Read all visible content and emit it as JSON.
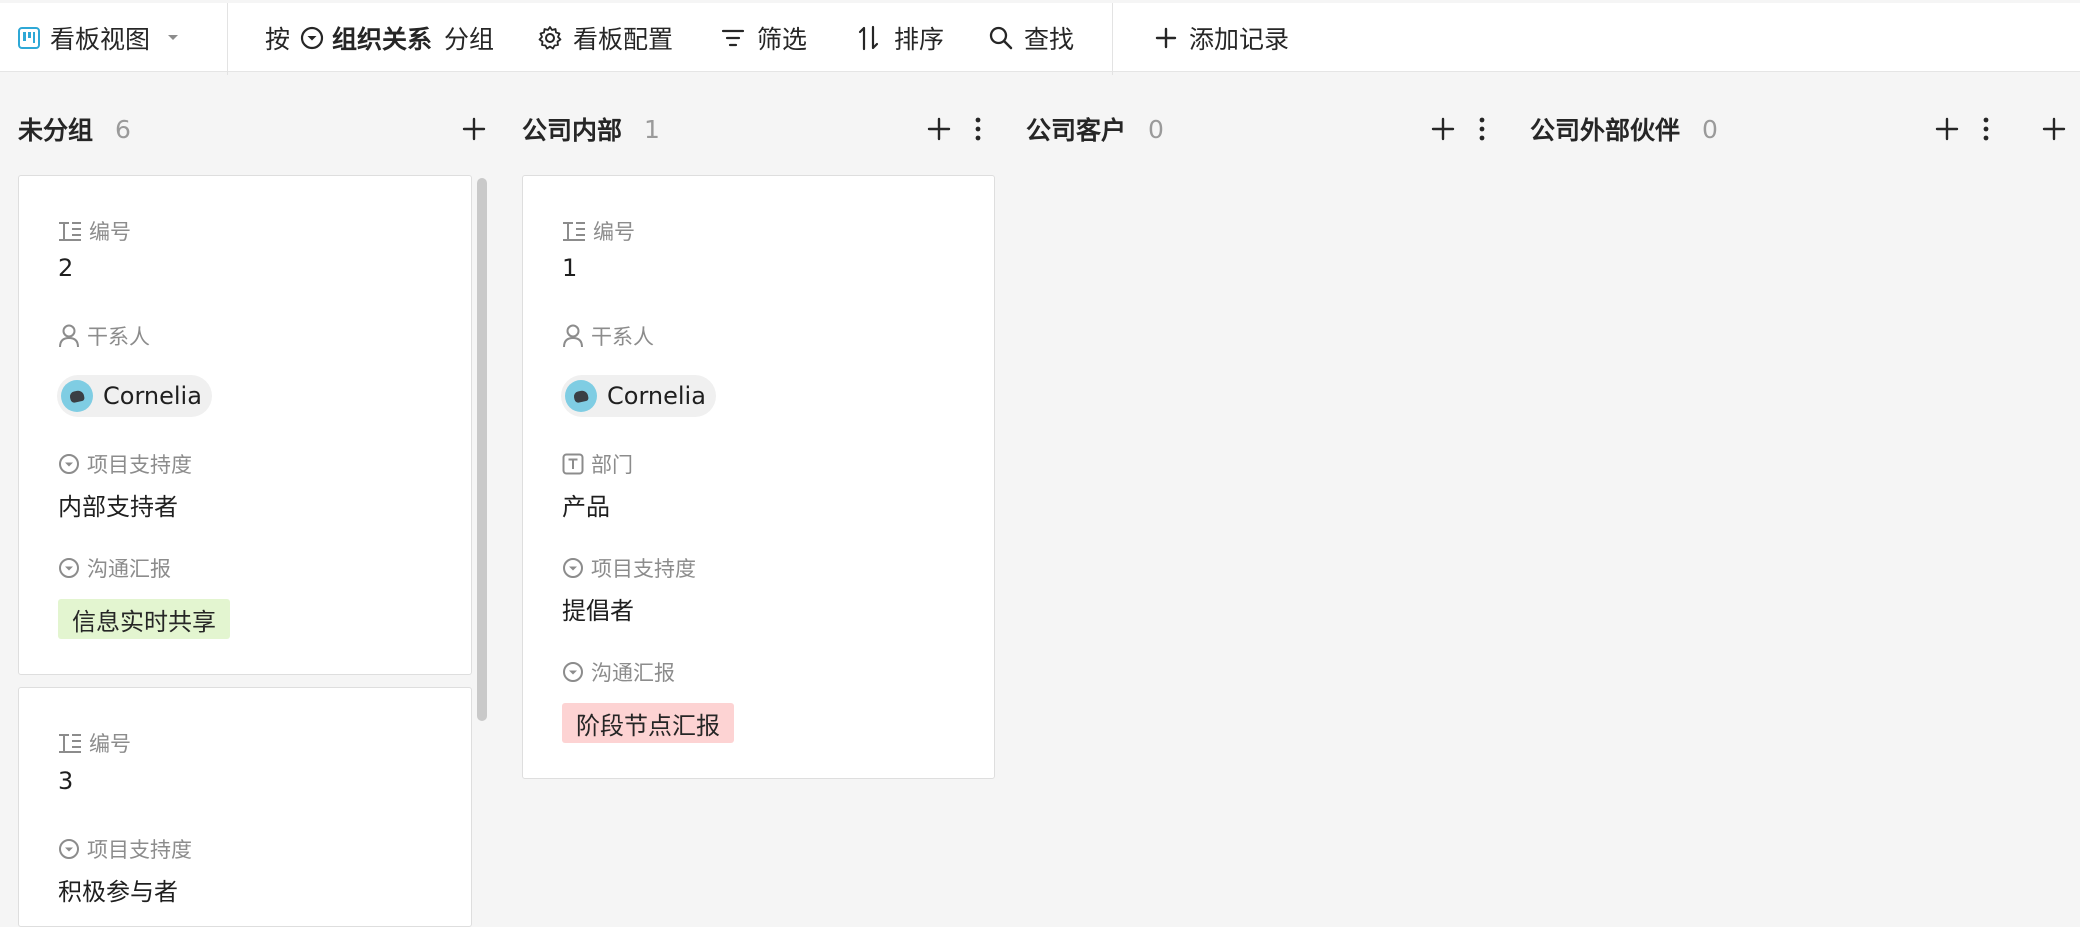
{
  "toolbar": {
    "view_label": "看板视图",
    "group_prefix": "按",
    "group_field": "组织关系",
    "group_suffix": "分组",
    "config_label": "看板配置",
    "filter_label": "筛选",
    "sort_label": "排序",
    "find_label": "查找",
    "add_record_label": "添加记录"
  },
  "columns": [
    {
      "name": "未分组",
      "count": "6"
    },
    {
      "name": "公司内部",
      "count": "1"
    },
    {
      "name": "公司客户",
      "count": "0"
    },
    {
      "name": "公司外部伙伴",
      "count": "0"
    }
  ],
  "cards": {
    "c1": {
      "number_label": "编号",
      "number": "2",
      "stakeholder_label": "干系人",
      "stakeholder": "Cornelia",
      "support_label": "项目支持度",
      "support": "内部支持者",
      "report_label": "沟通汇报",
      "report": "信息实时共享"
    },
    "c2": {
      "number_label": "编号",
      "number": "3",
      "support_label": "项目支持度",
      "support": "积极参与者"
    },
    "c3": {
      "number_label": "编号",
      "number": "1",
      "stakeholder_label": "干系人",
      "stakeholder": "Cornelia",
      "dept_label": "部门",
      "dept": "产品",
      "support_label": "项目支持度",
      "support": "提倡者",
      "report_label": "沟通汇报",
      "report": "阶段节点汇报"
    }
  },
  "colors": {
    "tag_green_bg": "#e3f5d0",
    "tag_red_bg": "#fdd3d3",
    "accent_blue": "#2ea8d6"
  }
}
